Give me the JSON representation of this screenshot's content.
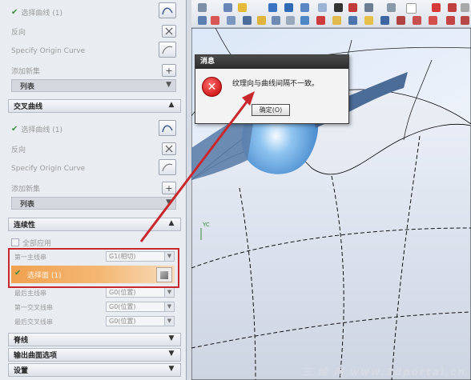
{
  "panel": {
    "sec1": {
      "select_curve": "选择曲线 (1)",
      "direction": "反向",
      "origin": "Specify Origin Curve",
      "add_set": "添加新集",
      "list": "列表"
    },
    "cross": {
      "header": "交叉曲线",
      "select_curve": "选择曲线 (1)",
      "direction": "反向",
      "origin": "Specify Origin Curve",
      "add_set": "添加新集",
      "list": "列表"
    },
    "cont": {
      "header": "连续性",
      "apply_all": "全部应用",
      "first_primary": "第一主线串",
      "first_primary_val": "G1(相切)",
      "select_face": "选择面 (1)",
      "last_primary": "最后主线串",
      "last_primary_val": "G0(位置)",
      "first_cross": "第一交叉线串",
      "first_cross_val": "G0(位置)",
      "last_cross": "最后交叉线串",
      "last_cross_val": "G0(位置)"
    },
    "spine": "脊线",
    "output": "输出曲面选项",
    "settings": "设置"
  },
  "dialog": {
    "title": "消息",
    "message": "纹理向与曲线间隔不一致。",
    "ok": "确定(O)"
  },
  "viewport": {
    "axis_label": "YC",
    "watermark": "三 维 网 www.3dportal.cn"
  },
  "colors": {
    "highlight": "#f2a04b",
    "annotation": "#c8272c",
    "dialog_title": "#2f2f2f",
    "surface_blue": "#6aa3d6",
    "surface_dark": "#4a6d9a"
  }
}
